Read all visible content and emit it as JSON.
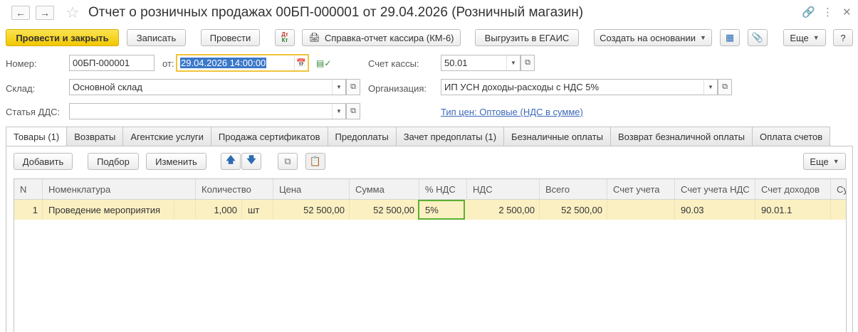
{
  "window": {
    "title": "Отчет о розничных продажах 00БП-000001 от 29.04.2026 (Розничный магазин)"
  },
  "toolbar": {
    "post_close": "Провести и закрыть",
    "save": "Записать",
    "post": "Провести",
    "dt_kt_icon": "Дт Кт",
    "cashier_report": "Справка-отчет кассира (КМ-6)",
    "egais": "Выгрузить в ЕГАИС",
    "create_based": "Создать на основании",
    "more": "Еще",
    "help": "?"
  },
  "form": {
    "number_label": "Номер:",
    "number_value": "00БП-000001",
    "date_label": "от:",
    "date_value": "29.04.2026 14:00:00",
    "warehouse_label": "Склад:",
    "warehouse_value": "Основной склад",
    "dds_label": "Статья ДДС:",
    "dds_value": "",
    "cash_account_label": "Счет кассы:",
    "cash_account_value": "50.01",
    "org_label": "Организация:",
    "org_value": "ИП УСН доходы-расходы с НДС 5%",
    "price_type_link": "Тип цен: Оптовые (НДС в сумме)"
  },
  "tabs": [
    "Товары (1)",
    "Возвраты",
    "Агентские услуги",
    "Продажа сертификатов",
    "Предоплаты",
    "Зачет предоплаты (1)",
    "Безналичные оплаты",
    "Возврат безналичной оплаты",
    "Оплата счетов"
  ],
  "table_toolbar": {
    "add": "Добавить",
    "pick": "Подбор",
    "edit": "Изменить",
    "more": "Еще"
  },
  "table": {
    "columns": [
      "N",
      "Номенклатура",
      "Количество",
      "Цена",
      "Сумма",
      "% НДС",
      "НДС",
      "Всего",
      "Счет учета",
      "Счет учета НДС",
      "Счет доходов",
      "Су"
    ],
    "rows": [
      {
        "n": "1",
        "item": "Проведение мероприятия",
        "qty": "1,000",
        "unit": "шт",
        "price": "52 500,00",
        "sum": "52 500,00",
        "vat_rate": "5%",
        "vat": "2 500,00",
        "total": "52 500,00",
        "account": "",
        "vat_account": "90.03",
        "income_account": "90.01.1"
      }
    ]
  },
  "colors": {
    "primary_button": "#f2c700",
    "highlight_row": "#fbf0c2",
    "date_focus_border": "#f0c43d",
    "vat_cell_border": "#5cb030",
    "link": "#3d69b8"
  }
}
